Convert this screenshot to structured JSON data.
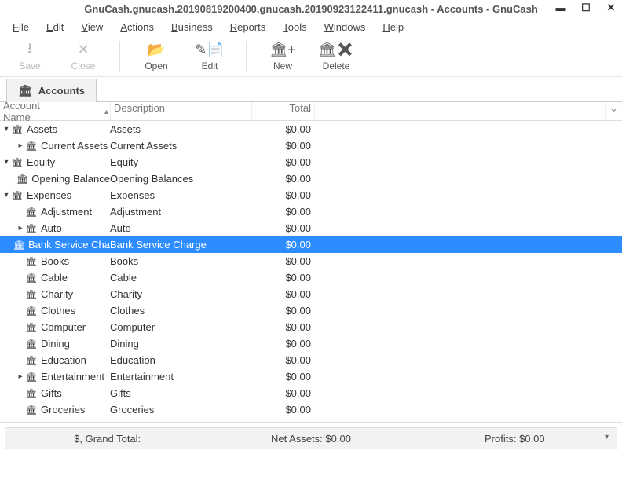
{
  "window": {
    "title": "GnuCash.gnucash.20190819200400.gnucash.20190923122411.gnucash - Accounts - GnuCash",
    "controls": {
      "min": "▬",
      "max": "☐",
      "close": "✕"
    }
  },
  "menu": {
    "items": [
      "File",
      "Edit",
      "View",
      "Actions",
      "Business",
      "Reports",
      "Tools",
      "Windows",
      "Help"
    ]
  },
  "toolbar": {
    "save": {
      "label": "Save",
      "icon": "⭳",
      "enabled": false
    },
    "close": {
      "label": "Close",
      "icon": "✕",
      "enabled": false
    },
    "open": {
      "label": "Open",
      "icon": "📂",
      "enabled": true
    },
    "edit": {
      "label": "Edit",
      "icon": "✎📄",
      "enabled": true
    },
    "new": {
      "label": "New",
      "icon": "🏛+",
      "enabled": true
    },
    "delete": {
      "label": "Delete",
      "icon": "🏛✖",
      "enabled": true
    }
  },
  "tabs": {
    "active": {
      "label": "Accounts",
      "icon": "🏛"
    }
  },
  "columns": {
    "name": "Account Name",
    "sort_glyph": "▲",
    "description": "Description",
    "total": "Total",
    "expand_glyph": "⌄"
  },
  "tree": [
    {
      "indent": 0,
      "disclosure": "down",
      "name": "Assets",
      "description": "Assets",
      "total": "$0.00",
      "selected": false
    },
    {
      "indent": 1,
      "disclosure": "right",
      "name": "Current Assets",
      "description": "Current Assets",
      "total": "$0.00",
      "selected": false
    },
    {
      "indent": 0,
      "disclosure": "down",
      "name": "Equity",
      "description": "Equity",
      "total": "$0.00",
      "selected": false
    },
    {
      "indent": 1,
      "disclosure": "none",
      "name": "Opening Balance",
      "description": "Opening Balances",
      "total": "$0.00",
      "selected": false
    },
    {
      "indent": 0,
      "disclosure": "down",
      "name": "Expenses",
      "description": "Expenses",
      "total": "$0.00",
      "selected": false
    },
    {
      "indent": 1,
      "disclosure": "none",
      "name": "Adjustment",
      "description": "Adjustment",
      "total": "$0.00",
      "selected": false
    },
    {
      "indent": 1,
      "disclosure": "right",
      "name": "Auto",
      "description": "Auto",
      "total": "$0.00",
      "selected": false
    },
    {
      "indent": 1,
      "disclosure": "none",
      "name": "Bank Service Cha",
      "description": "Bank Service Charge",
      "total": "$0.00",
      "selected": true
    },
    {
      "indent": 1,
      "disclosure": "none",
      "name": "Books",
      "description": "Books",
      "total": "$0.00",
      "selected": false
    },
    {
      "indent": 1,
      "disclosure": "none",
      "name": "Cable",
      "description": "Cable",
      "total": "$0.00",
      "selected": false
    },
    {
      "indent": 1,
      "disclosure": "none",
      "name": "Charity",
      "description": "Charity",
      "total": "$0.00",
      "selected": false
    },
    {
      "indent": 1,
      "disclosure": "none",
      "name": "Clothes",
      "description": "Clothes",
      "total": "$0.00",
      "selected": false
    },
    {
      "indent": 1,
      "disclosure": "none",
      "name": "Computer",
      "description": "Computer",
      "total": "$0.00",
      "selected": false
    },
    {
      "indent": 1,
      "disclosure": "none",
      "name": "Dining",
      "description": "Dining",
      "total": "$0.00",
      "selected": false
    },
    {
      "indent": 1,
      "disclosure": "none",
      "name": "Education",
      "description": "Education",
      "total": "$0.00",
      "selected": false
    },
    {
      "indent": 1,
      "disclosure": "right",
      "name": "Entertainment",
      "description": "Entertainment",
      "total": "$0.00",
      "selected": false
    },
    {
      "indent": 1,
      "disclosure": "none",
      "name": "Gifts",
      "description": "Gifts",
      "total": "$0.00",
      "selected": false
    },
    {
      "indent": 1,
      "disclosure": "none",
      "name": "Groceries",
      "description": "Groceries",
      "total": "$0.00",
      "selected": false
    }
  ],
  "status": {
    "left": "$, Grand Total:",
    "center": "Net Assets: $0.00",
    "right": "Profits: $0.00",
    "drop_glyph": "▾"
  },
  "icons": {
    "account": "🏛"
  }
}
